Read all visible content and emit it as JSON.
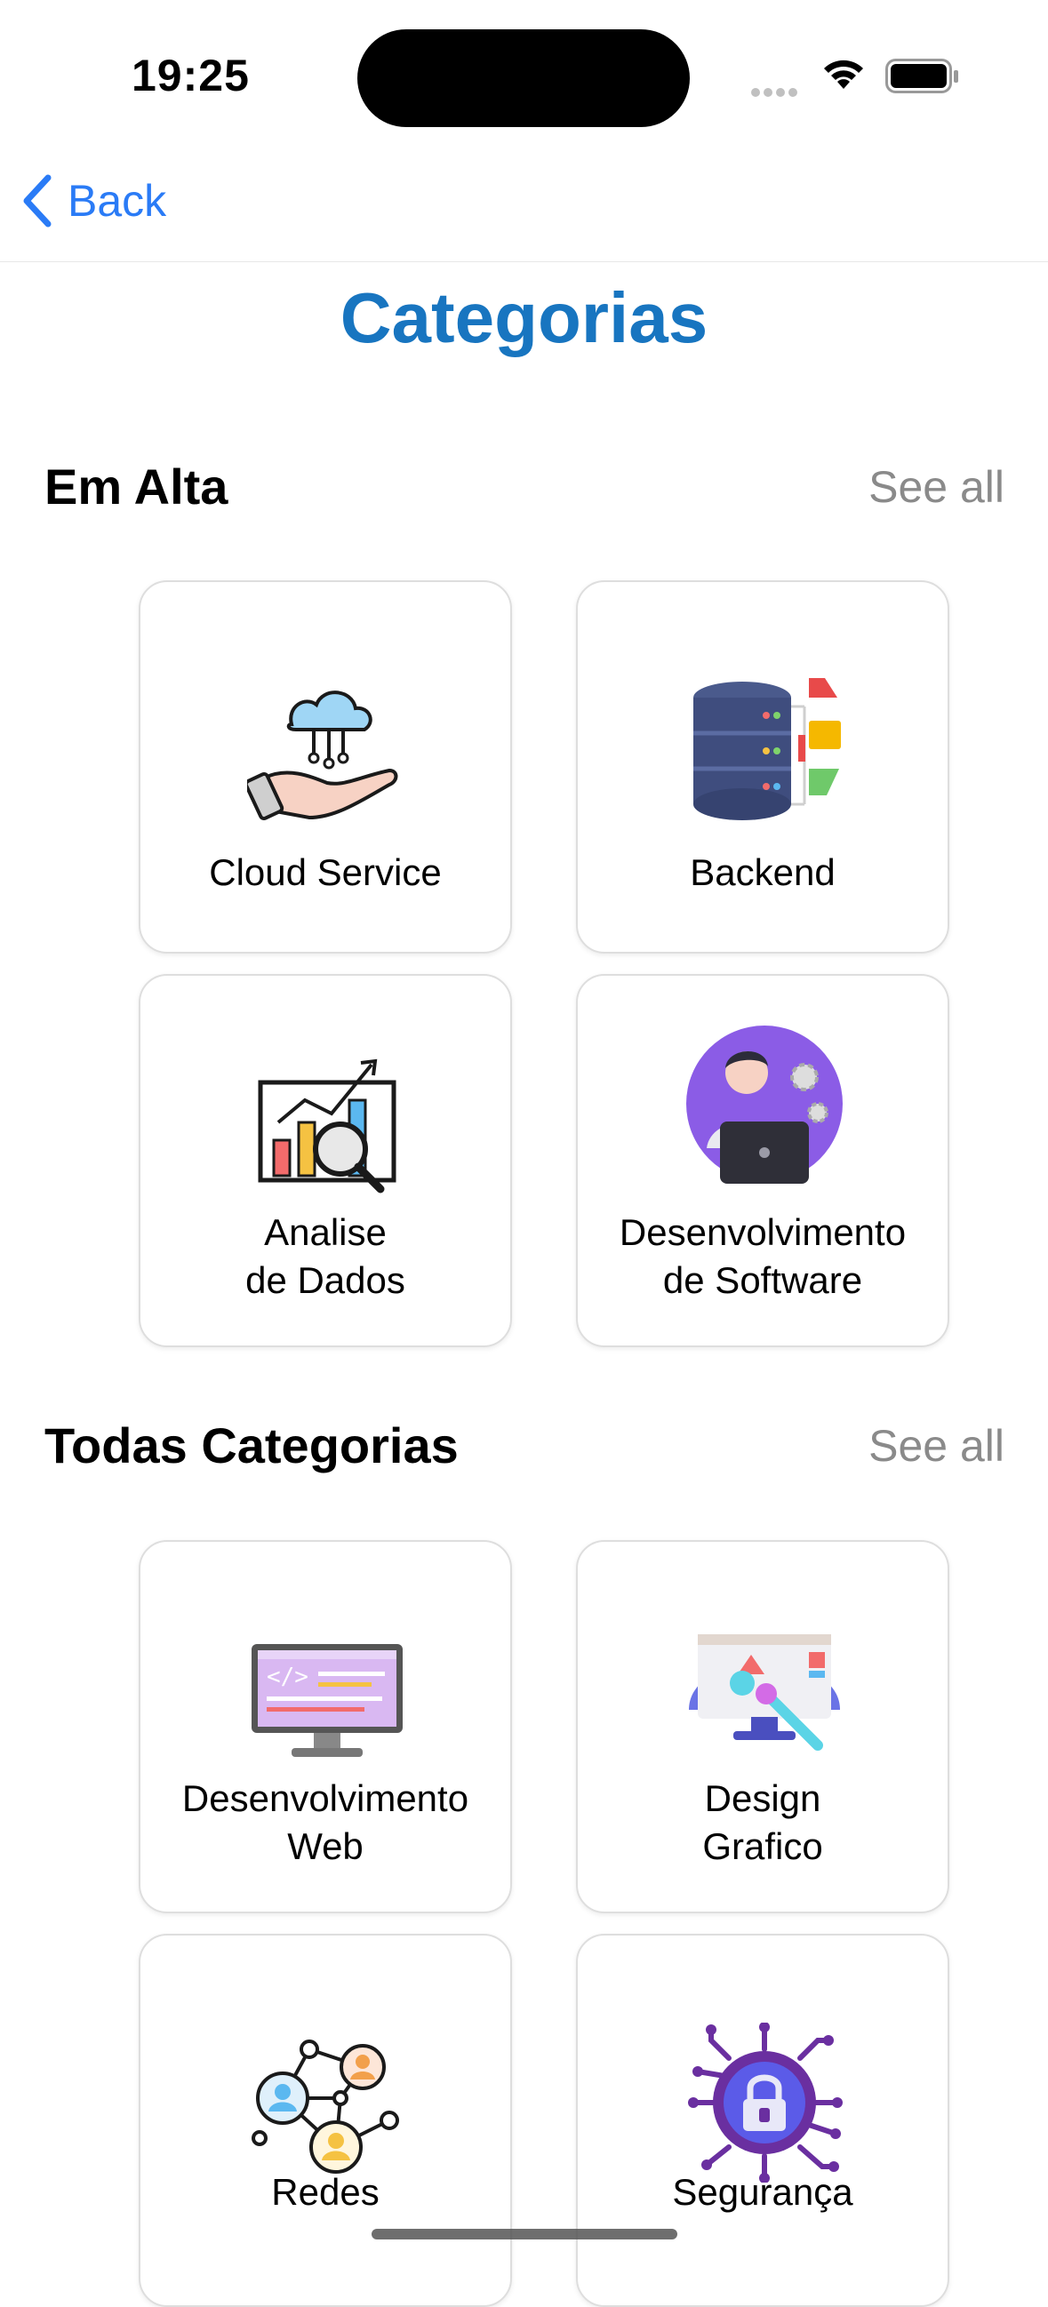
{
  "status_bar": {
    "time": "19:25"
  },
  "nav": {
    "back_label": "Back"
  },
  "page": {
    "title": "Categorias"
  },
  "sections": [
    {
      "title": "Em Alta",
      "see_all": "See all",
      "cards": [
        {
          "label": "Cloud Service",
          "icon": "cloud-hand-icon"
        },
        {
          "label": "Backend",
          "icon": "server-database-icon"
        },
        {
          "label": "Analise\nde Dados",
          "icon": "data-chart-icon"
        },
        {
          "label": "Desenvolvimento\nde Software",
          "icon": "software-developer-icon"
        }
      ]
    },
    {
      "title": "Todas Categorias",
      "see_all": "See all",
      "cards": [
        {
          "label": "Desenvolvimento\nWeb",
          "icon": "web-monitor-icon"
        },
        {
          "label": "Design\nGrafico",
          "icon": "graphic-design-icon"
        },
        {
          "label": "Redes",
          "icon": "network-people-icon"
        },
        {
          "label": "Segurança",
          "icon": "security-lock-icon"
        }
      ]
    }
  ],
  "colors": {
    "accent": "#2a7bf6",
    "title": "#1875c0",
    "muted": "#8a8a8a"
  }
}
